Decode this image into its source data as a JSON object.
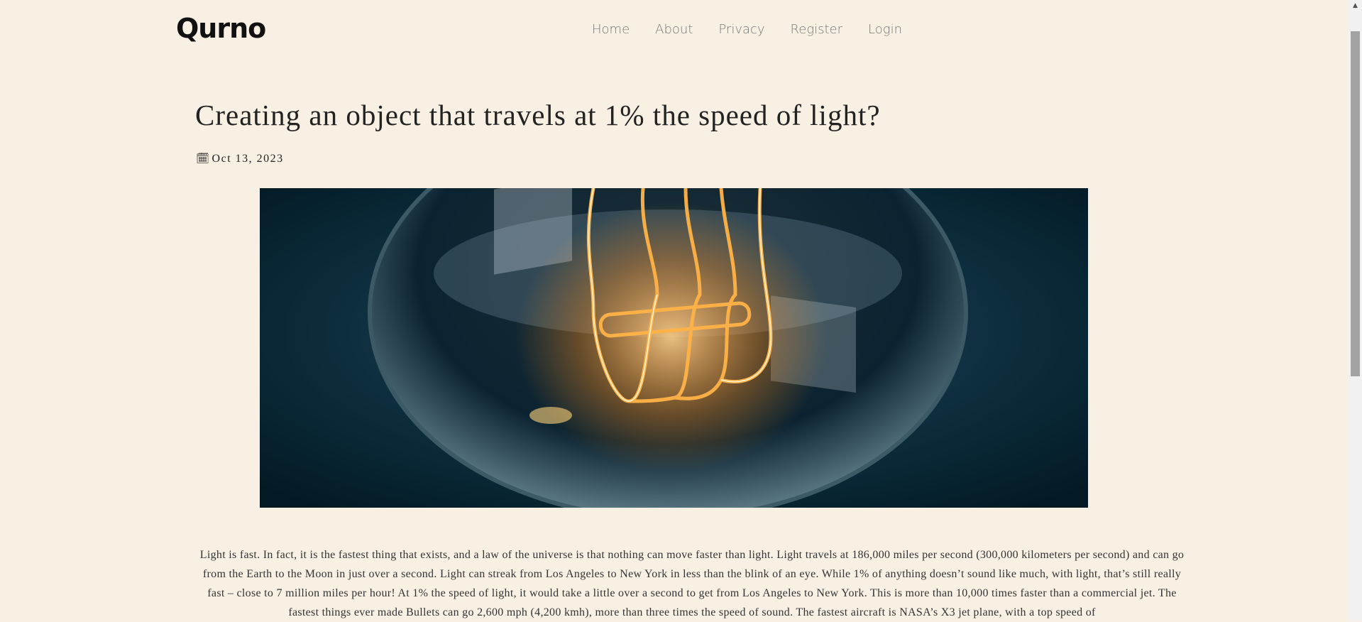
{
  "header": {
    "logo": "Qurno",
    "nav": [
      "Home",
      "About",
      "Privacy",
      "Register",
      "Login"
    ]
  },
  "post": {
    "title": "Creating an object that travels at 1% the speed of light?",
    "date": "Oct 13, 2023",
    "body": "Light is fast. In fact, it is the fastest thing that exists, and a law of the universe is that nothing can move faster than light. Light travels at 186,000 miles per second (300,000 kilometers per second) and can go from the Earth to the Moon in just over a second. Light can streak from Los Angeles to New York in less than the blink of an eye. While 1% of anything doesn’t sound like much, with light, that’s still really fast – close to 7 million miles per hour! At 1% the speed of light, it would take a little over a second to get from Los Angeles to New York. This is more than 10,000 times faster than a commercial jet. The fastest things ever made Bullets can go 2,600 mph (4,200 kmh), more than three times the speed of sound. The fastest aircraft is NASA’s X3 jet plane, with a top speed of"
  },
  "icons": {
    "date": "calendar-icon",
    "scroll": "scroll-up-arrow-icon"
  },
  "colors": {
    "background": "#f8f0e3",
    "text": "#222222",
    "nav": "#777777"
  }
}
